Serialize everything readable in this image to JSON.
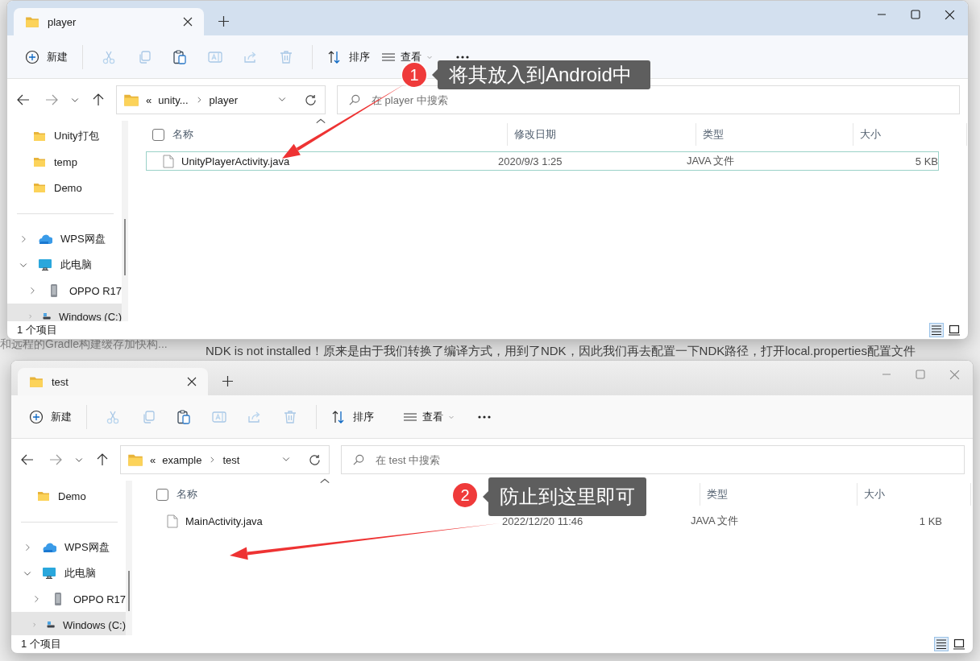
{
  "background_page": {
    "lines": [
      {
        "kind": "sidebar",
        "text": "和远程的Gradle构建缓存加快构..."
      },
      {
        "kind": "body",
        "text": "NDK is not installed！原来是由于我们转换了编译方式，用到了NDK，因此我们再去配置一下NDK路径，打开local.properties配置文件"
      }
    ]
  },
  "windows": [
    {
      "active": true,
      "tabs": [
        {
          "label": "player",
          "selected": true
        }
      ],
      "toolbar": {
        "new_label": "新建",
        "sort_label": "排序",
        "view_label": "查看",
        "actions": [
          {
            "kind": "cut",
            "disabled": true
          },
          {
            "kind": "copy",
            "disabled": true
          },
          {
            "kind": "paste",
            "disabled": false
          },
          {
            "kind": "rename",
            "disabled": true
          },
          {
            "kind": "share",
            "disabled": true
          },
          {
            "kind": "delete",
            "disabled": true
          }
        ]
      },
      "address": {
        "overflow": "«",
        "segments": [
          "unity...",
          "player"
        ]
      },
      "search": {
        "placeholder": "在 player 中搜索"
      },
      "quick_access": [
        {
          "label": "Unity打包",
          "selected": false
        },
        {
          "label": "temp",
          "selected": false
        },
        {
          "label": "Demo",
          "selected": false
        }
      ],
      "tree": [
        {
          "label": "WPS网盘",
          "kind": "cloud",
          "expanded": false,
          "selected": false
        },
        {
          "label": "此电脑",
          "kind": "computer",
          "expanded": true,
          "selected": false,
          "children": [
            {
              "label": "OPPO R17",
              "kind": "phone",
              "expanded": false,
              "selected": false
            },
            {
              "label": "Windows (C:)",
              "kind": "drive",
              "expanded": false,
              "selected": true
            }
          ]
        }
      ],
      "select_all_checked": false,
      "columns": [
        {
          "label": "名称"
        },
        {
          "label": "修改日期"
        },
        {
          "label": "类型"
        },
        {
          "label": "大小"
        }
      ],
      "rows": [
        {
          "cells": [
            "UnityPlayerActivity.java",
            "2020/9/3 1:25",
            "JAVA 文件",
            "5 KB"
          ],
          "selected": true
        }
      ],
      "status": "1 个项目",
      "view_buttons": [
        {
          "kind": "details",
          "selected": true
        },
        {
          "kind": "tiles",
          "selected": false
        }
      ]
    },
    {
      "active": false,
      "tabs": [
        {
          "label": "test",
          "selected": true
        }
      ],
      "toolbar": {
        "new_label": "新建",
        "sort_label": "排序",
        "view_label": "查看",
        "actions": [
          {
            "kind": "cut",
            "disabled": true
          },
          {
            "kind": "copy",
            "disabled": true
          },
          {
            "kind": "paste",
            "disabled": false
          },
          {
            "kind": "rename",
            "disabled": true
          },
          {
            "kind": "share",
            "disabled": true
          },
          {
            "kind": "delete",
            "disabled": true
          }
        ]
      },
      "address": {
        "overflow": "«",
        "segments": [
          "example",
          "test"
        ]
      },
      "search": {
        "placeholder": "在 test 中搜索"
      },
      "quick_access": [
        {
          "label": "Demo",
          "selected": false
        }
      ],
      "tree": [
        {
          "label": "WPS网盘",
          "kind": "cloud",
          "expanded": false,
          "selected": false
        },
        {
          "label": "此电脑",
          "kind": "computer",
          "expanded": true,
          "selected": false,
          "children": [
            {
              "label": "OPPO R17",
              "kind": "phone",
              "expanded": false,
              "selected": false
            },
            {
              "label": "Windows (C:)",
              "kind": "drive",
              "expanded": false,
              "selected": true
            }
          ]
        }
      ],
      "select_all_checked": false,
      "columns": [
        {
          "label": "名称"
        },
        {},
        {
          "label": "类型"
        },
        {
          "label": "大小"
        }
      ],
      "rows": [
        {
          "cells": [
            "MainActivity.java",
            "2022/12/20 11:46",
            "JAVA 文件",
            "1 KB"
          ],
          "selected": false
        }
      ],
      "status": "1 个项目",
      "view_buttons": [
        {
          "kind": "details",
          "selected": true
        },
        {
          "kind": "tiles",
          "selected": false
        }
      ]
    }
  ],
  "callouts": [
    {
      "number": "1",
      "text": "将其放入到Android中"
    },
    {
      "number": "2",
      "text": "防止到这里即可"
    }
  ]
}
